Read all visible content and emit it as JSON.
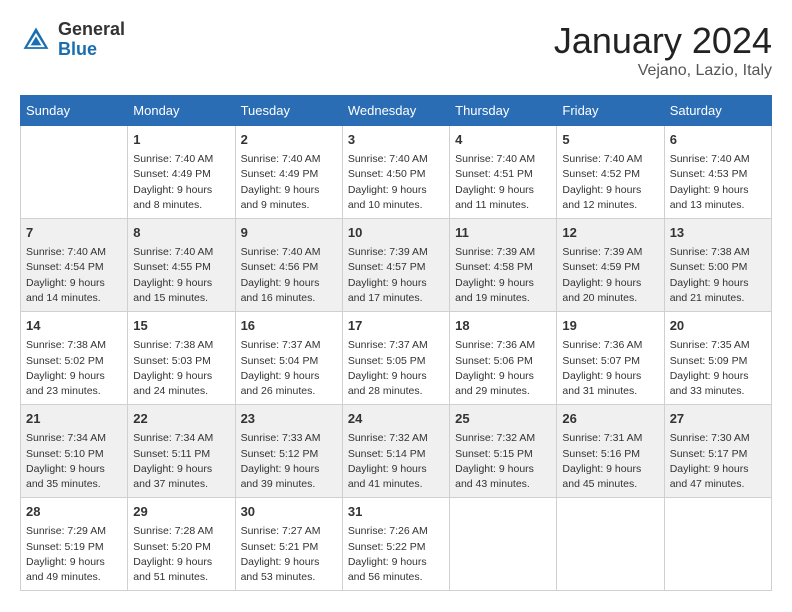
{
  "header": {
    "logo_general": "General",
    "logo_blue": "Blue",
    "month_title": "January 2024",
    "location": "Vejano, Lazio, Italy"
  },
  "days_of_week": [
    "Sunday",
    "Monday",
    "Tuesday",
    "Wednesday",
    "Thursday",
    "Friday",
    "Saturday"
  ],
  "weeks": [
    [
      {
        "day": "",
        "info": ""
      },
      {
        "day": "1",
        "info": "Sunrise: 7:40 AM\nSunset: 4:49 PM\nDaylight: 9 hours\nand 8 minutes."
      },
      {
        "day": "2",
        "info": "Sunrise: 7:40 AM\nSunset: 4:49 PM\nDaylight: 9 hours\nand 9 minutes."
      },
      {
        "day": "3",
        "info": "Sunrise: 7:40 AM\nSunset: 4:50 PM\nDaylight: 9 hours\nand 10 minutes."
      },
      {
        "day": "4",
        "info": "Sunrise: 7:40 AM\nSunset: 4:51 PM\nDaylight: 9 hours\nand 11 minutes."
      },
      {
        "day": "5",
        "info": "Sunrise: 7:40 AM\nSunset: 4:52 PM\nDaylight: 9 hours\nand 12 minutes."
      },
      {
        "day": "6",
        "info": "Sunrise: 7:40 AM\nSunset: 4:53 PM\nDaylight: 9 hours\nand 13 minutes."
      }
    ],
    [
      {
        "day": "7",
        "info": "Sunrise: 7:40 AM\nSunset: 4:54 PM\nDaylight: 9 hours\nand 14 minutes."
      },
      {
        "day": "8",
        "info": "Sunrise: 7:40 AM\nSunset: 4:55 PM\nDaylight: 9 hours\nand 15 minutes."
      },
      {
        "day": "9",
        "info": "Sunrise: 7:40 AM\nSunset: 4:56 PM\nDaylight: 9 hours\nand 16 minutes."
      },
      {
        "day": "10",
        "info": "Sunrise: 7:39 AM\nSunset: 4:57 PM\nDaylight: 9 hours\nand 17 minutes."
      },
      {
        "day": "11",
        "info": "Sunrise: 7:39 AM\nSunset: 4:58 PM\nDaylight: 9 hours\nand 19 minutes."
      },
      {
        "day": "12",
        "info": "Sunrise: 7:39 AM\nSunset: 4:59 PM\nDaylight: 9 hours\nand 20 minutes."
      },
      {
        "day": "13",
        "info": "Sunrise: 7:38 AM\nSunset: 5:00 PM\nDaylight: 9 hours\nand 21 minutes."
      }
    ],
    [
      {
        "day": "14",
        "info": "Sunrise: 7:38 AM\nSunset: 5:02 PM\nDaylight: 9 hours\nand 23 minutes."
      },
      {
        "day": "15",
        "info": "Sunrise: 7:38 AM\nSunset: 5:03 PM\nDaylight: 9 hours\nand 24 minutes."
      },
      {
        "day": "16",
        "info": "Sunrise: 7:37 AM\nSunset: 5:04 PM\nDaylight: 9 hours\nand 26 minutes."
      },
      {
        "day": "17",
        "info": "Sunrise: 7:37 AM\nSunset: 5:05 PM\nDaylight: 9 hours\nand 28 minutes."
      },
      {
        "day": "18",
        "info": "Sunrise: 7:36 AM\nSunset: 5:06 PM\nDaylight: 9 hours\nand 29 minutes."
      },
      {
        "day": "19",
        "info": "Sunrise: 7:36 AM\nSunset: 5:07 PM\nDaylight: 9 hours\nand 31 minutes."
      },
      {
        "day": "20",
        "info": "Sunrise: 7:35 AM\nSunset: 5:09 PM\nDaylight: 9 hours\nand 33 minutes."
      }
    ],
    [
      {
        "day": "21",
        "info": "Sunrise: 7:34 AM\nSunset: 5:10 PM\nDaylight: 9 hours\nand 35 minutes."
      },
      {
        "day": "22",
        "info": "Sunrise: 7:34 AM\nSunset: 5:11 PM\nDaylight: 9 hours\nand 37 minutes."
      },
      {
        "day": "23",
        "info": "Sunrise: 7:33 AM\nSunset: 5:12 PM\nDaylight: 9 hours\nand 39 minutes."
      },
      {
        "day": "24",
        "info": "Sunrise: 7:32 AM\nSunset: 5:14 PM\nDaylight: 9 hours\nand 41 minutes."
      },
      {
        "day": "25",
        "info": "Sunrise: 7:32 AM\nSunset: 5:15 PM\nDaylight: 9 hours\nand 43 minutes."
      },
      {
        "day": "26",
        "info": "Sunrise: 7:31 AM\nSunset: 5:16 PM\nDaylight: 9 hours\nand 45 minutes."
      },
      {
        "day": "27",
        "info": "Sunrise: 7:30 AM\nSunset: 5:17 PM\nDaylight: 9 hours\nand 47 minutes."
      }
    ],
    [
      {
        "day": "28",
        "info": "Sunrise: 7:29 AM\nSunset: 5:19 PM\nDaylight: 9 hours\nand 49 minutes."
      },
      {
        "day": "29",
        "info": "Sunrise: 7:28 AM\nSunset: 5:20 PM\nDaylight: 9 hours\nand 51 minutes."
      },
      {
        "day": "30",
        "info": "Sunrise: 7:27 AM\nSunset: 5:21 PM\nDaylight: 9 hours\nand 53 minutes."
      },
      {
        "day": "31",
        "info": "Sunrise: 7:26 AM\nSunset: 5:22 PM\nDaylight: 9 hours\nand 56 minutes."
      },
      {
        "day": "",
        "info": ""
      },
      {
        "day": "",
        "info": ""
      },
      {
        "day": "",
        "info": ""
      }
    ]
  ]
}
